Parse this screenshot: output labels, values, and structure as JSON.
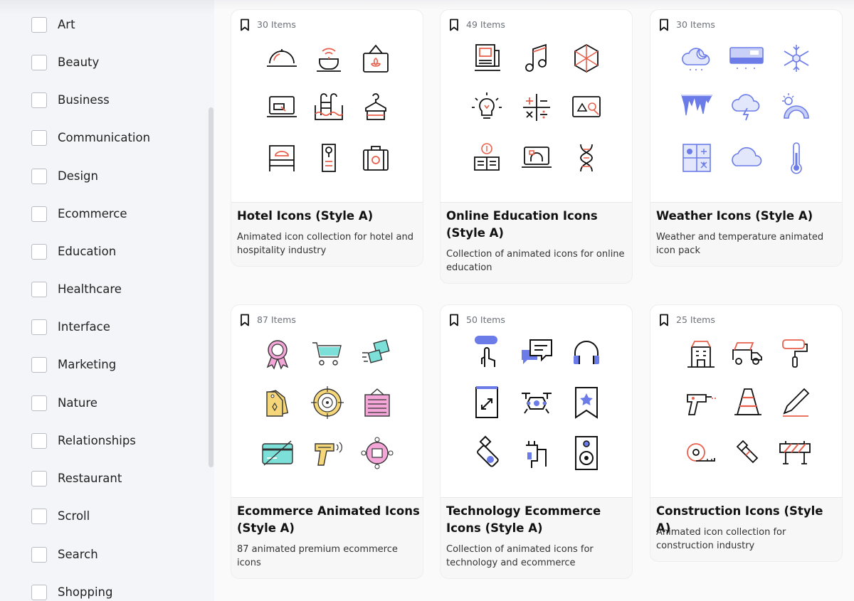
{
  "sidebar": {
    "categories": [
      {
        "label": "Art"
      },
      {
        "label": "Beauty"
      },
      {
        "label": "Business"
      },
      {
        "label": "Communication"
      },
      {
        "label": "Design"
      },
      {
        "label": "Ecommerce"
      },
      {
        "label": "Education"
      },
      {
        "label": "Healthcare"
      },
      {
        "label": "Interface"
      },
      {
        "label": "Marketing"
      },
      {
        "label": "Nature"
      },
      {
        "label": "Relationships"
      },
      {
        "label": "Restaurant"
      },
      {
        "label": "Scroll"
      },
      {
        "label": "Search"
      },
      {
        "label": "Shopping"
      }
    ]
  },
  "cards": [
    {
      "count": "30 Items",
      "title": "Hotel Icons (Style A)",
      "description": "Animated icon collection for hotel and hospitality industry"
    },
    {
      "count": "49 Items",
      "title": "Online Education Icons (Style A)",
      "description": "Collection of animated icons for online education"
    },
    {
      "count": "30 Items",
      "title": "Weather Icons (Style A)",
      "description": "Weather and temperature animated icon pack"
    },
    {
      "count": "87 Items",
      "title": "Ecommerce Animated Icons (Style A)",
      "description": "87 animated premium ecommerce icons"
    },
    {
      "count": "50 Items",
      "title": "Technology Ecommerce Icons (Style A)",
      "description": "Collection of animated icons for technology and ecommerce"
    },
    {
      "count": "25 Items",
      "title": "Construction Icons (Style A)",
      "description": "Animated icon collection for construction industry"
    }
  ],
  "colors": {
    "accent_red": "#e8604c",
    "accent_blue": "#6b7ce8",
    "accent_pink": "#f4a6d8",
    "accent_teal": "#7de0d8",
    "accent_yellow": "#f5d77a"
  }
}
